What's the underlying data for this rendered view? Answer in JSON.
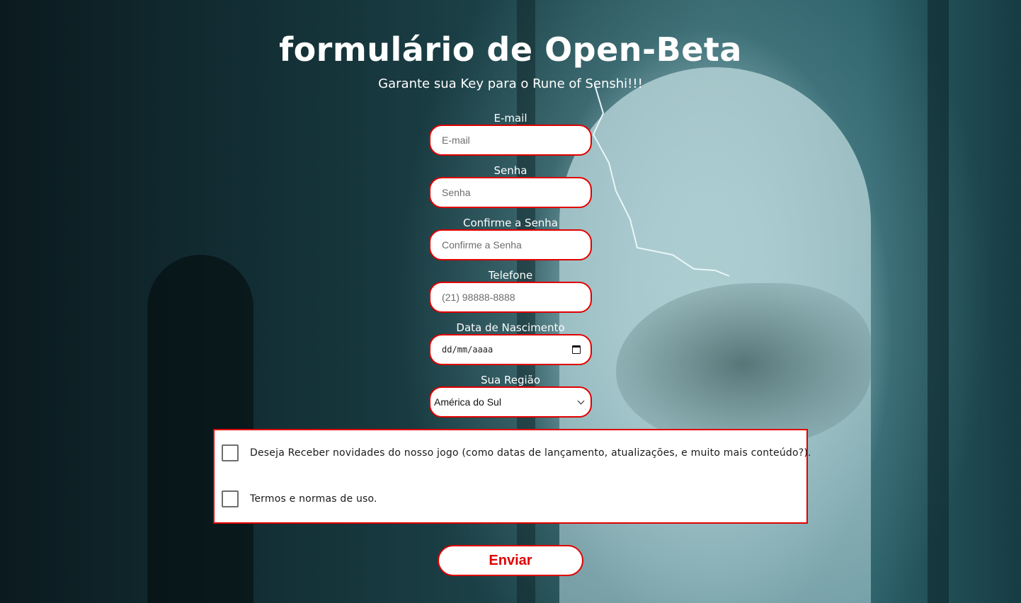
{
  "header": {
    "title": "formulário de Open-Beta",
    "subtitle": "Garante sua Key para o Rune of Senshi!!!"
  },
  "form": {
    "email": {
      "label": "E-mail",
      "placeholder": "E-mail",
      "value": ""
    },
    "password": {
      "label": "Senha",
      "placeholder": "Senha",
      "value": ""
    },
    "confirm_password": {
      "label": "Confirme a Senha",
      "placeholder": "Confirme a Senha",
      "value": ""
    },
    "phone": {
      "label": "Telefone",
      "placeholder": "(21) 98888-8888",
      "value": ""
    },
    "birth_date": {
      "label": "Data de Nascimento",
      "display": "dd/mm/aaaa"
    },
    "region": {
      "label": "Sua Região",
      "selected": "América do Sul"
    }
  },
  "checkboxes": {
    "newsletter": {
      "label": "Deseja Receber novidades do nosso jogo (como datas de lançamento, atualizações, e muito mais conteúdo?).",
      "checked": false
    },
    "terms": {
      "label": "Termos e normas de uso.",
      "checked": false
    }
  },
  "actions": {
    "submit_label": "Enviar"
  },
  "colors": {
    "accent": "#e00000",
    "text_on_background": "#ffffff",
    "field_background": "#ffffff"
  }
}
